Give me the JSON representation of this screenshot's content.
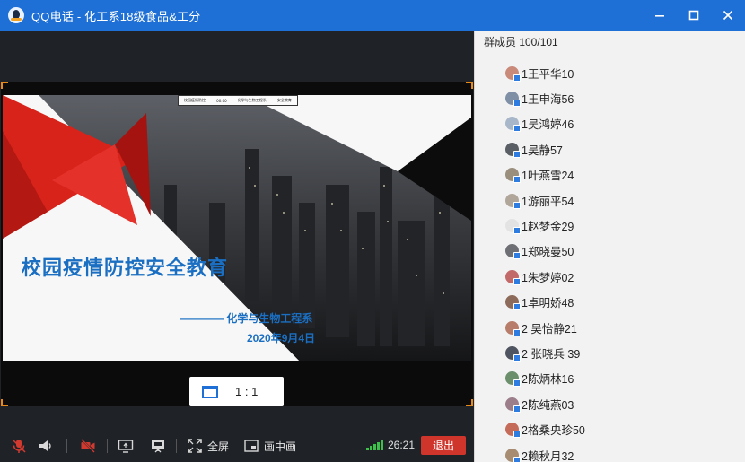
{
  "window": {
    "title": "QQ电话 - 化工系18级食品&工分",
    "controls": [
      "minimize-icon",
      "maximize-icon",
      "close-icon"
    ]
  },
  "slide": {
    "topbar_items": [
      "校园疫情防控",
      "00:00",
      "化学与生物工程系",
      "安全教育"
    ],
    "title": "校园疫情防控安全教育",
    "department": "———— 化学与生物工程系",
    "date": "2020年9月4日"
  },
  "view": {
    "ratio_label": "1 : 1"
  },
  "toolbar": {
    "fullscreen_label": "全屏",
    "pip_label": "画中画",
    "timer": "26:21",
    "exit_label": "退出",
    "signal_color": "#3cc24a"
  },
  "members": {
    "header": "群成员 100/101",
    "items": [
      {
        "name": "1王平华10",
        "avatar_color": "#c98a7a"
      },
      {
        "name": "1王申海56",
        "avatar_color": "#7f8fa6"
      },
      {
        "name": "1吴鸿婷46",
        "avatar_color": "#a7b7c9"
      },
      {
        "name": "1吴静57",
        "avatar_color": "#5a5f66"
      },
      {
        "name": "1叶燕雪24",
        "avatar_color": "#9a8f7d"
      },
      {
        "name": "1游丽平54",
        "avatar_color": "#b0a69a"
      },
      {
        "name": "1赵梦金29",
        "avatar_color": "#e3e3e3"
      },
      {
        "name": "1郑晓曼50",
        "avatar_color": "#6d6f74"
      },
      {
        "name": "1朱梦婷02",
        "avatar_color": "#c26a6a"
      },
      {
        "name": "1卓明娇48",
        "avatar_color": "#8d6b5a"
      },
      {
        "name": "2 吴怡静21",
        "avatar_color": "#b87d6a"
      },
      {
        "name": "2 张晓兵 39",
        "avatar_color": "#4f5560"
      },
      {
        "name": "2陈炳林16",
        "avatar_color": "#6b8e6b"
      },
      {
        "name": "2陈纯燕03",
        "avatar_color": "#9c7d8a"
      },
      {
        "name": "2格桑央珍50",
        "avatar_color": "#c46b5a"
      },
      {
        "name": "2赖秋月32",
        "avatar_color": "#a88c72"
      }
    ]
  }
}
